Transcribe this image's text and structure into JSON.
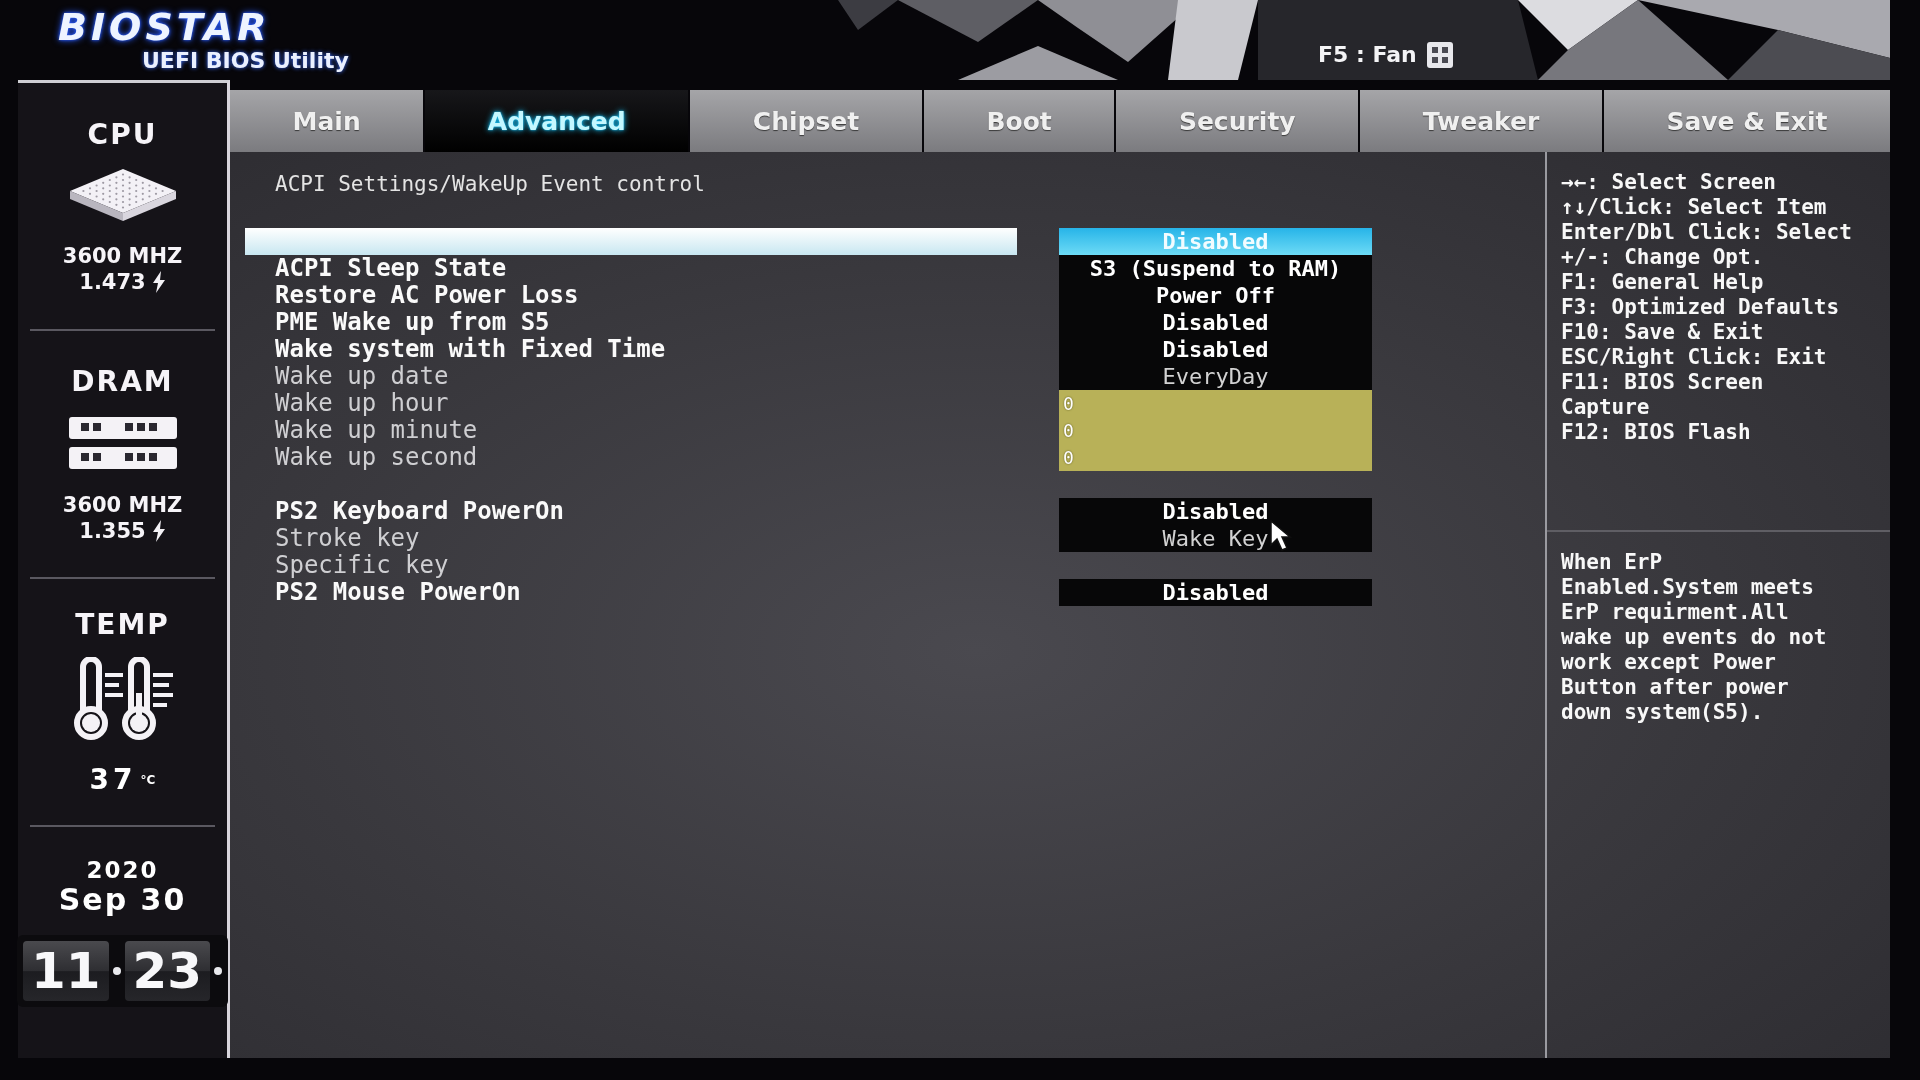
{
  "header": {
    "brand": "BIOSTAR",
    "subtitle": "UEFI BIOS Utility",
    "hotkey": "F5 : Fan"
  },
  "sidebar": {
    "monitors": [
      {
        "kind": "cpu",
        "title": "CPU",
        "frequency": "3600 MHZ",
        "voltage": "1.473"
      },
      {
        "kind": "dram",
        "title": "DRAM",
        "frequency": "3600 MHZ",
        "voltage": "1.355"
      },
      {
        "kind": "temp",
        "title": "TEMP",
        "value": "37",
        "unit": "°C"
      }
    ],
    "date": {
      "year": "2020",
      "day": "Sep 30"
    },
    "clock": {
      "hours": "11",
      "minutes": "23"
    }
  },
  "tabs": [
    {
      "label": "Main",
      "selected": false
    },
    {
      "label": "Advanced",
      "selected": true
    },
    {
      "label": "Chipset",
      "selected": false
    },
    {
      "label": "Boot",
      "selected": false
    },
    {
      "label": "Security",
      "selected": false
    },
    {
      "label": "Tweaker",
      "selected": false
    },
    {
      "label": "Save & Exit",
      "selected": false
    }
  ],
  "page": {
    "breadcrumb": "ACPI Settings/WakeUp Event control",
    "setting_groups": [
      {
        "items": [
          {
            "kind": "option",
            "value": "Disabled",
            "selected": true,
            "disabled": false
          },
          {
            "label": "ACPI Sleep State",
            "kind": "option",
            "value": "S3 (Suspend to RAM)",
            "selected": false,
            "disabled": false
          },
          {
            "label": "Restore AC Power Loss",
            "kind": "option",
            "value": "Power Off",
            "selected": false,
            "disabled": false
          },
          {
            "label": "PME Wake up from S5",
            "kind": "option",
            "value": "Disabled",
            "selected": false,
            "disabled": false
          },
          {
            "label": "Wake system with Fixed Time",
            "kind": "option",
            "value": "Disabled",
            "selected": false,
            "disabled": false
          },
          {
            "label": "Wake up date",
            "kind": "option",
            "value": "EveryDay",
            "selected": false,
            "disabled": true
          },
          {
            "label": "Wake up hour",
            "kind": "number",
            "value": "0",
            "selected": false,
            "disabled": true
          },
          {
            "label": "Wake up minute",
            "kind": "number",
            "value": "0",
            "selected": false,
            "disabled": true
          },
          {
            "label": "Wake up second",
            "kind": "number",
            "value": "0",
            "selected": false,
            "disabled": true
          }
        ]
      },
      {
        "items": [
          {
            "label": "PS2 Keyboard PowerOn",
            "kind": "option",
            "value": "Disabled",
            "selected": false,
            "disabled": false
          },
          {
            "label": "Stroke key",
            "kind": "option",
            "value": "Wake Key",
            "selected": false,
            "disabled": true
          },
          {
            "label": "Specific key",
            "kind": "plain",
            "selected": false,
            "disabled": true
          },
          {
            "label": "PS2 Mouse PowerOn",
            "kind": "option",
            "value": "Disabled",
            "selected": false,
            "disabled": false
          }
        ]
      }
    ]
  },
  "help": {
    "keys": [
      "→←: Select Screen",
      "↑↓/Click: Select Item",
      "Enter/Dbl Click: Select",
      "+/-: Change Opt.",
      "F1: General Help",
      "F3: Optimized Defaults",
      "F10: Save & Exit",
      "ESC/Right Click: Exit",
      "F11: BIOS Screen Capture",
      "F12: BIOS Flash"
    ],
    "description": "When ErP Enabled.System meets ErP requirment.All wake up events do not work except Power Button after power down system(S5)."
  }
}
